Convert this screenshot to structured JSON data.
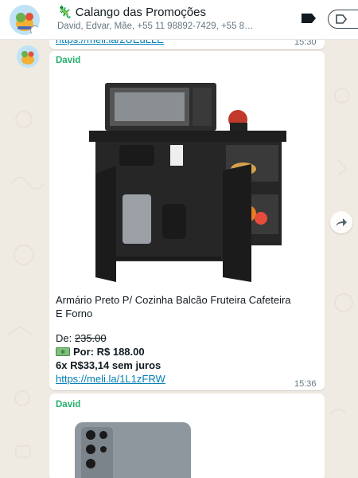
{
  "header": {
    "title": "Calango das Promoções",
    "members": "David, Edvar, Mãe, +55 11 98892-7429, +55 8…",
    "title_icon": "lizard-emoji"
  },
  "messages": [
    {
      "partial_link": "https://meli.la/2UEuLLE",
      "time": "15:30"
    },
    {
      "sender": "David",
      "product_title": "Armário Preto P/ Cozinha Balcão Fruteira Cafeteira E Forno",
      "price_old_label": "De:",
      "price_old_value": "235.00",
      "price_new_icon": "money-emoji",
      "price_new": "Por: R$ 188.00",
      "installments": "6x R$33,14 sem juros",
      "link": "https://meli.la/1L1zFRW",
      "time": "15:36"
    },
    {
      "sender": "David"
    }
  ],
  "colors": {
    "background": "#efeae2",
    "bubble": "#ffffff",
    "sender": "#25b16b",
    "link": "#027eb5"
  }
}
